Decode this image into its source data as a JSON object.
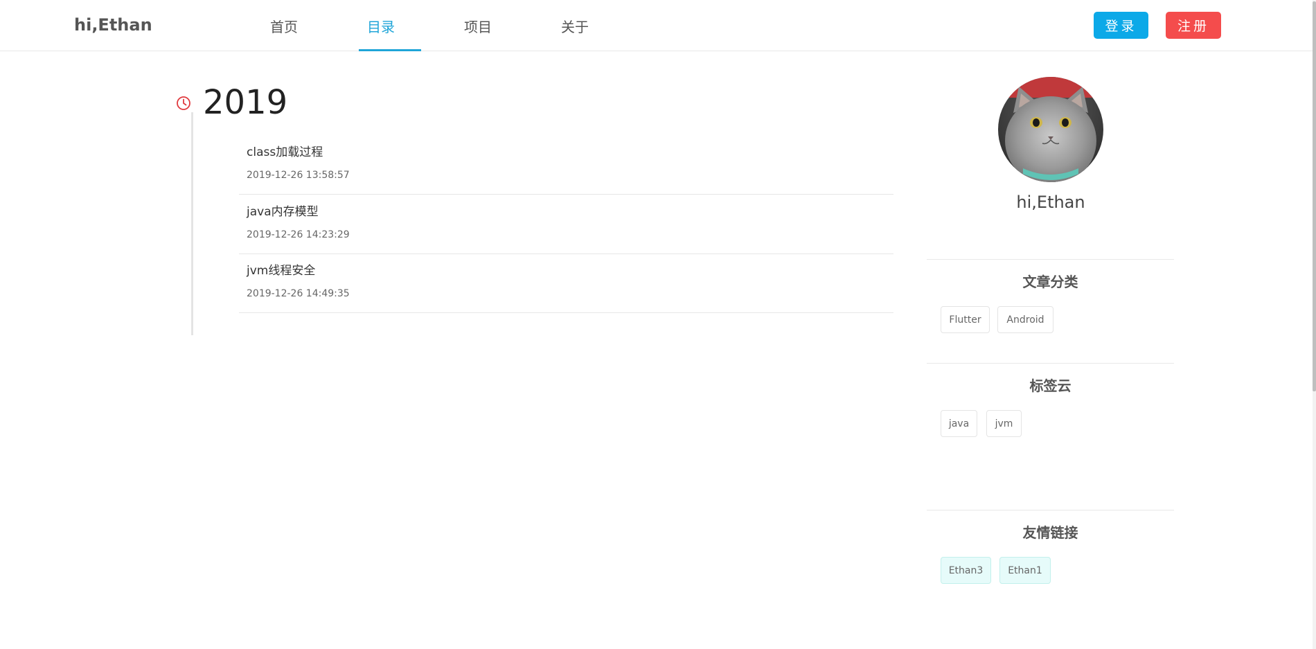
{
  "header": {
    "brand": "hi,Ethan",
    "nav": [
      "首页",
      "目录",
      "项目",
      "关于"
    ],
    "active_nav": "目录",
    "login_label": "登录",
    "register_label": "注册"
  },
  "timeline": {
    "year": "2019",
    "posts": [
      {
        "title": "class加载过程",
        "date": "2019-12-26 13:58:57"
      },
      {
        "title": "java内存模型",
        "date": "2019-12-26 14:23:29"
      },
      {
        "title": "jvm线程安全",
        "date": "2019-12-26 14:49:35"
      }
    ]
  },
  "sidebar": {
    "profile_name": "hi,Ethan",
    "categories": {
      "title": "文章分类",
      "items": [
        "Flutter",
        "Android"
      ]
    },
    "tags": {
      "title": "标签云",
      "items": [
        "java",
        "jvm"
      ]
    },
    "links": {
      "title": "友情链接",
      "items": [
        "Ethan3",
        "Ethan1"
      ]
    }
  },
  "colors": {
    "accent": "#1fa5d8",
    "login_button": "#0ca9e8",
    "register_button": "#f44c4c",
    "clock_icon": "#e0393e",
    "link_tag_bg": "#e6fbfa"
  }
}
